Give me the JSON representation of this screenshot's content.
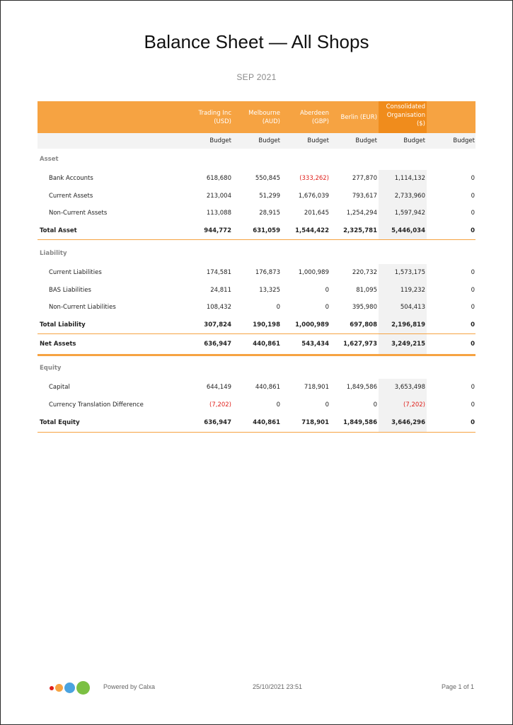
{
  "report": {
    "title": "Balance Sheet — All Shops",
    "period": "SEP 2021"
  },
  "columns": [
    {
      "header": "Trading Inc (USD)",
      "line1": "Trading Inc",
      "line2": "(USD)",
      "sub": "Budget"
    },
    {
      "header": "Melbourne (AUD)",
      "line1": "Melbourne",
      "line2": "(AUD)",
      "sub": "Budget"
    },
    {
      "header": "Aberdeen (GBP)",
      "line1": "Aberdeen",
      "line2": "(GBP)",
      "sub": "Budget"
    },
    {
      "header": "Berlin (EUR)",
      "line1": "Berlin (EUR)",
      "line2": "",
      "sub": "Budget"
    },
    {
      "header": "Consolidated Organisation ($)",
      "line1": "Consolidated",
      "line2": "Organisation",
      "line3": "($)",
      "sub": "Budget"
    },
    {
      "header": "",
      "line1": "",
      "line2": "",
      "sub": "Budget"
    }
  ],
  "sections": {
    "asset": {
      "label": "Asset",
      "rows": [
        {
          "label": "Bank Accounts",
          "values": [
            "618,680",
            "550,845",
            "(333,262)",
            "277,870",
            "1,114,132",
            "0"
          ]
        },
        {
          "label": "Current Assets",
          "values": [
            "213,004",
            "51,299",
            "1,676,039",
            "793,617",
            "2,733,960",
            "0"
          ]
        },
        {
          "label": "Non-Current Assets",
          "values": [
            "113,088",
            "28,915",
            "201,645",
            "1,254,294",
            "1,597,942",
            "0"
          ]
        }
      ],
      "total": {
        "label": "Total Asset",
        "values": [
          "944,772",
          "631,059",
          "1,544,422",
          "2,325,781",
          "5,446,034",
          "0"
        ]
      }
    },
    "liability": {
      "label": "Liability",
      "rows": [
        {
          "label": "Current Liabilities",
          "values": [
            "174,581",
            "176,873",
            "1,000,989",
            "220,732",
            "1,573,175",
            "0"
          ]
        },
        {
          "label": "BAS Liabilities",
          "values": [
            "24,811",
            "13,325",
            "0",
            "81,095",
            "119,232",
            "0"
          ]
        },
        {
          "label": "Non-Current Liabilities",
          "values": [
            "108,432",
            "0",
            "0",
            "395,980",
            "504,413",
            "0"
          ]
        }
      ],
      "total": {
        "label": "Total Liability",
        "values": [
          "307,824",
          "190,198",
          "1,000,989",
          "697,808",
          "2,196,819",
          "0"
        ]
      }
    },
    "net_assets": {
      "label": "Net Assets",
      "values": [
        "636,947",
        "440,861",
        "543,434",
        "1,627,973",
        "3,249,215",
        "0"
      ]
    },
    "equity": {
      "label": "Equity",
      "rows": [
        {
          "label": "Capital",
          "values": [
            "644,149",
            "440,861",
            "718,901",
            "1,849,586",
            "3,653,498",
            "0"
          ]
        },
        {
          "label": "Currency Translation Difference",
          "values": [
            "(7,202)",
            "0",
            "0",
            "0",
            "(7,202)",
            "0"
          ]
        }
      ],
      "total": {
        "label": "Total Equity",
        "values": [
          "636,947",
          "440,861",
          "718,901",
          "1,849,586",
          "3,646,296",
          "0"
        ]
      }
    }
  },
  "footer": {
    "powered_by": "Powered by Calxa",
    "timestamp": "25/10/2021 23:51",
    "page": "Page 1 of 1"
  },
  "colors": {
    "accent": "#f6a342",
    "accent_dark": "#f08c1c",
    "negative": "#e0201b",
    "logo_dots": [
      "#e0201b",
      "#f6a342",
      "#4aa3e0",
      "#7bc043"
    ]
  }
}
